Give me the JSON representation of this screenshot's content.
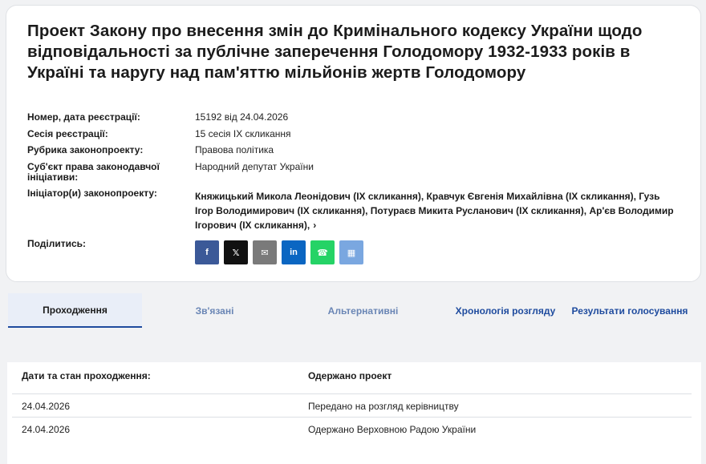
{
  "bill": {
    "title": "Проект Закону про внесення змін до Кримінального кодексу України щодо відповідальності за публічне заперечення Голодомору 1932-1933 років в Україні та наругу над пам'яттю мільйонів жертв Голодомору",
    "fields": {
      "number_label": "Номер, дата реєстрації:",
      "number_value": "15192 від 24.04.2026",
      "session_label": "Сесія реєстрації:",
      "session_value": "15 сесія IX скликання",
      "rubric_label": "Рубрика законопроекту:",
      "rubric_value": "Правова політика",
      "subject_label": "Суб'єкт права законодавчої ініціативи:",
      "subject_value": "Народний депутат України",
      "initiators_label": "Ініціатор(и) законопроекту:",
      "initiators_value": "Княжицький Микола Леонідович (IX скликання), Кравчук Євгенія Михайлівна (IX скликання), Гузь Ігор Володимирович (IX скликання), Потураєв Микита Русланович (IX скликання), Ар'єв Володимир Ігорович (IX скликання),",
      "share_label": "Поділитись:"
    },
    "share_buttons": [
      {
        "name": "facebook",
        "glyph": "f",
        "color": "#3b5998"
      },
      {
        "name": "x",
        "glyph": "𝕏",
        "color": "#111111"
      },
      {
        "name": "email",
        "glyph": "✉",
        "color": "#7a7a7a"
      },
      {
        "name": "linkedin",
        "glyph": "in",
        "color": "#0a66c2"
      },
      {
        "name": "whatsapp",
        "glyph": "☎",
        "color": "#25d366"
      },
      {
        "name": "qr",
        "glyph": "▦",
        "color": "#7aa7e0"
      }
    ]
  },
  "tabs": {
    "passage": "Проходження",
    "related": "Зв'язані",
    "alternative": "Альтернативні",
    "chronology": "Хронологія розгляду",
    "voting": "Результати голосування"
  },
  "passage_table": {
    "header_date": "Дати та стан проходження:",
    "header_status": "Одержано проект",
    "rows": [
      {
        "date": "24.04.2026",
        "status": "Передано на розгляд керівництву"
      },
      {
        "date": "24.04.2026",
        "status": "Одержано Верховною Радою України"
      }
    ]
  }
}
